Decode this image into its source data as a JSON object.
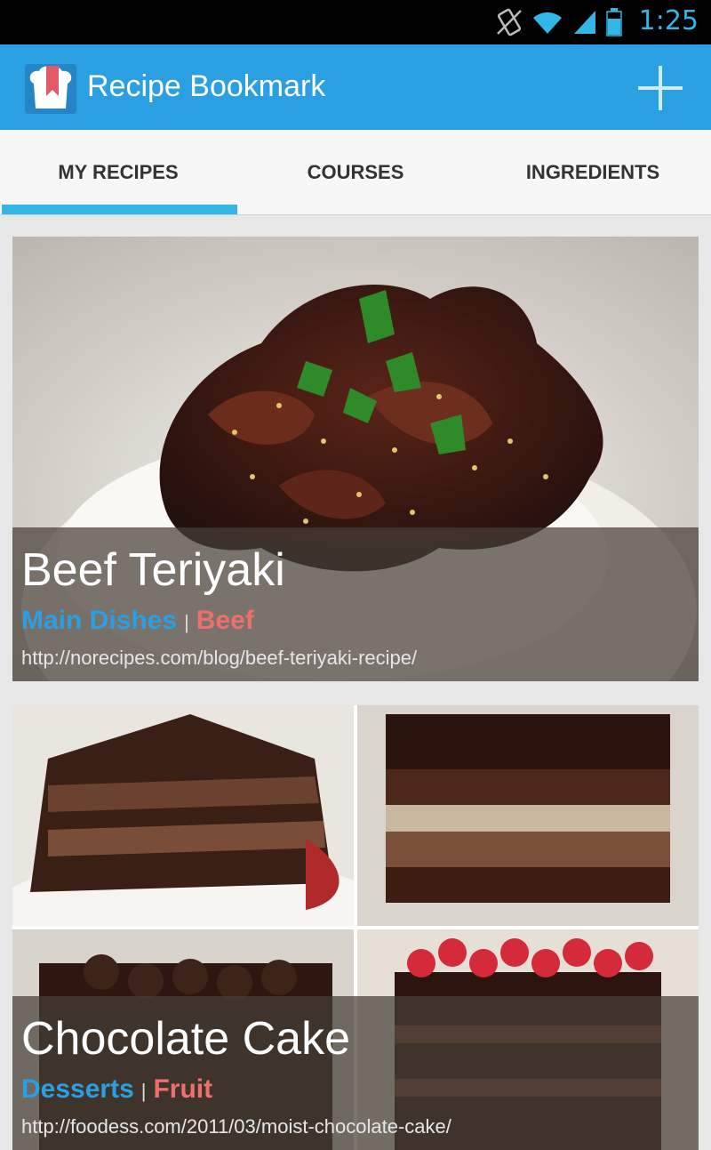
{
  "status_bar": {
    "time": "1:25",
    "icons": [
      "vibrate-icon",
      "wifi-icon",
      "signal-icon",
      "battery-icon"
    ]
  },
  "action_bar": {
    "title": "Recipe Bookmark",
    "add_icon": "plus-icon"
  },
  "tabs": [
    {
      "label": "MY RECIPES",
      "selected": true
    },
    {
      "label": "COURSES",
      "selected": false
    },
    {
      "label": "INGREDIENTS",
      "selected": false
    }
  ],
  "recipes": [
    {
      "title": "Beef Teriyaki",
      "course": "Main Dishes",
      "separator": "|",
      "ingredient": "Beef",
      "url": "http://norecipes.com/blog/beef-teriyaki-recipe/"
    },
    {
      "title": "Chocolate Cake",
      "course": "Desserts",
      "separator": "|",
      "ingredient": "Fruit",
      "url": "http://foodess.com/2011/03/moist-chocolate-cake/"
    }
  ],
  "colors": {
    "accent": "#33b5e5",
    "action_bar": "#2a9fe2",
    "course_tag": "#2a9fe2",
    "ingredient_tag": "#f06e6e"
  }
}
